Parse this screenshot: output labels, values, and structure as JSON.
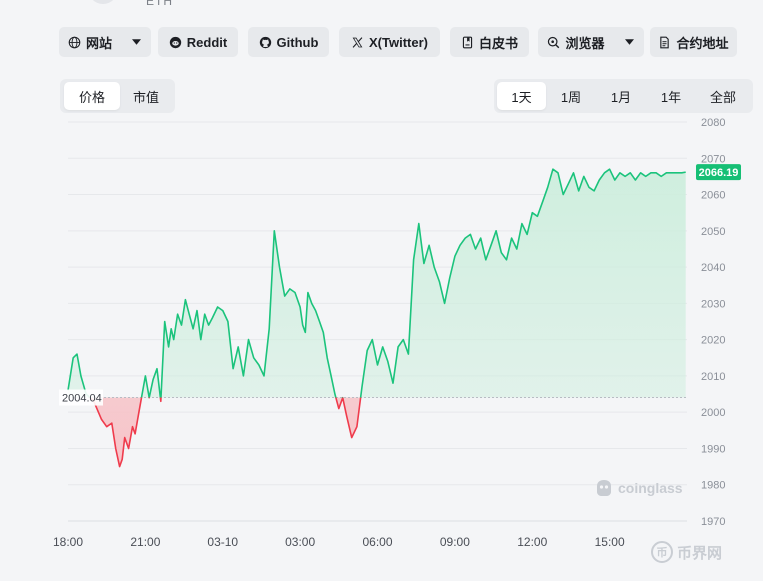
{
  "header": {
    "symbol": "ETH"
  },
  "links": {
    "website": "网站",
    "reddit": "Reddit",
    "github": "Github",
    "twitter": "X(Twitter)",
    "whitepaper": "白皮书",
    "explorer": "浏览器",
    "contract": "合约地址"
  },
  "metric_tabs": {
    "price": "价格",
    "market_cap": "市值",
    "active": "价格"
  },
  "range_tabs": {
    "d1": "1天",
    "w1": "1周",
    "m1": "1月",
    "y1": "1年",
    "all": "全部",
    "active": "1天"
  },
  "watermark": "coinglass",
  "site_logo": {
    "glyph": "币",
    "name": "币界网"
  },
  "colors": {
    "up": "#1bc37c",
    "down": "#ef3b4c",
    "up_fill": "#cdeedd",
    "down_fill": "#f7c1c6",
    "badge": "#16bf75"
  },
  "chart_data": {
    "type": "area",
    "x_ticks": [
      "18:00",
      "21:00",
      "03-10",
      "03:00",
      "06:00",
      "09:00",
      "12:00",
      "15:00"
    ],
    "y_ticks": [
      1970,
      1980,
      1990,
      2000,
      2010,
      2020,
      2030,
      2040,
      2050,
      2060,
      2070,
      2080
    ],
    "ylim": [
      1970,
      2080
    ],
    "baseline": 2004.04,
    "baseline_label": "2004.04",
    "last_value": 2066.19,
    "last_label": "2066.19",
    "x_unit_note": "",
    "x_hours": [
      0,
      0.2,
      0.35,
      0.5,
      0.7,
      1.0,
      1.3,
      1.5,
      1.7,
      1.85,
      2.0,
      2.1,
      2.2,
      2.35,
      2.5,
      2.6,
      2.75,
      2.9,
      3.0,
      3.15,
      3.3,
      3.45,
      3.6,
      3.75,
      3.9,
      4.0,
      4.1,
      4.25,
      4.4,
      4.55,
      4.7,
      4.85,
      5.0,
      5.15,
      5.3,
      5.45,
      5.6,
      5.8,
      6.0,
      6.2,
      6.4,
      6.6,
      6.8,
      7.0,
      7.2,
      7.4,
      7.6,
      7.8,
      8.0,
      8.2,
      8.4,
      8.6,
      8.8,
      9.0,
      9.1,
      9.2,
      9.3,
      9.45,
      9.6,
      9.75,
      9.9,
      10.05,
      10.2,
      10.35,
      10.5,
      10.65,
      10.8,
      11.0,
      11.2,
      11.4,
      11.6,
      11.8,
      12.0,
      12.2,
      12.4,
      12.6,
      12.8,
      13.0,
      13.2,
      13.4,
      13.6,
      13.8,
      14.0,
      14.2,
      14.4,
      14.6,
      14.8,
      15.0,
      15.2,
      15.4,
      15.6,
      15.8,
      16.0,
      16.2,
      16.4,
      16.6,
      16.8,
      17.0,
      17.2,
      17.4,
      17.6,
      17.8,
      18.0,
      18.2,
      18.4,
      18.6,
      18.8,
      19.0,
      19.2,
      19.4,
      19.6,
      19.8,
      20.0,
      20.2,
      20.4,
      20.6,
      20.8,
      21.0,
      21.2,
      21.4,
      21.6,
      21.8,
      22.0,
      22.2,
      22.4,
      22.6,
      22.8,
      23.0,
      23.2,
      23.4,
      23.6,
      23.8,
      23.95
    ],
    "y": [
      2006,
      2015,
      2016,
      2010,
      2005,
      2003,
      1998,
      1996,
      1997,
      1990,
      1985,
      1987,
      1993,
      1990,
      1996,
      1994,
      2000,
      2006,
      2010,
      2004,
      2009,
      2012,
      2003,
      2025,
      2018,
      2023,
      2020,
      2027,
      2024,
      2031,
      2027,
      2023,
      2028,
      2020,
      2027,
      2024,
      2026,
      2029,
      2028,
      2025,
      2012,
      2018,
      2010,
      2020,
      2015,
      2013,
      2010,
      2023,
      2050,
      2040,
      2032,
      2034,
      2033,
      2029,
      2024,
      2022,
      2033,
      2030,
      2028,
      2025,
      2022,
      2015,
      2010,
      2005,
      2001,
      2004,
      1999,
      1993,
      1996,
      2007,
      2017,
      2020,
      2013,
      2018,
      2014,
      2008,
      2018,
      2020,
      2016,
      2042,
      2052,
      2041,
      2046,
      2040,
      2036,
      2030,
      2037,
      2043,
      2046,
      2048,
      2049,
      2045,
      2048,
      2042,
      2046,
      2050,
      2044,
      2042,
      2048,
      2045,
      2052,
      2049,
      2055,
      2054,
      2058,
      2062,
      2067,
      2066,
      2060,
      2063,
      2066,
      2061,
      2065,
      2062,
      2061,
      2064,
      2066,
      2067,
      2064,
      2066,
      2065,
      2066,
      2064,
      2066,
      2065,
      2066,
      2066,
      2065,
      2066,
      2066,
      2066,
      2066,
      2066.19
    ]
  }
}
